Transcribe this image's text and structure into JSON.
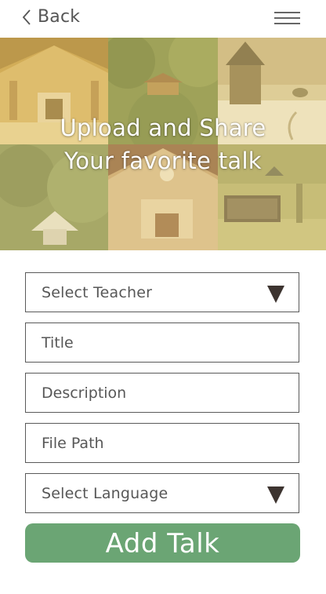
{
  "header": {
    "back_label": "Back",
    "back_icon": "chevron-left-icon",
    "menu_icon": "hamburger-menu-icon"
  },
  "hero": {
    "title_line1": "Upload and Share",
    "title_line2": "Your favorite talk",
    "overlay_color": "#ecdaa0"
  },
  "form": {
    "teacher_select": {
      "value": "Select Teacher",
      "icon": "dropdown-triangle-icon"
    },
    "title_field": {
      "placeholder": "Title",
      "value": ""
    },
    "description_field": {
      "placeholder": "Description",
      "value": ""
    },
    "file_path_field": {
      "placeholder": "File Path",
      "value": ""
    },
    "language_select": {
      "value": "Select Language",
      "icon": "dropdown-triangle-icon"
    },
    "add_button_label": "Add Talk"
  },
  "colors": {
    "accent_green": "#6ba574",
    "border": "#5a5a5a",
    "dropdown_arrow": "#3d3430"
  }
}
